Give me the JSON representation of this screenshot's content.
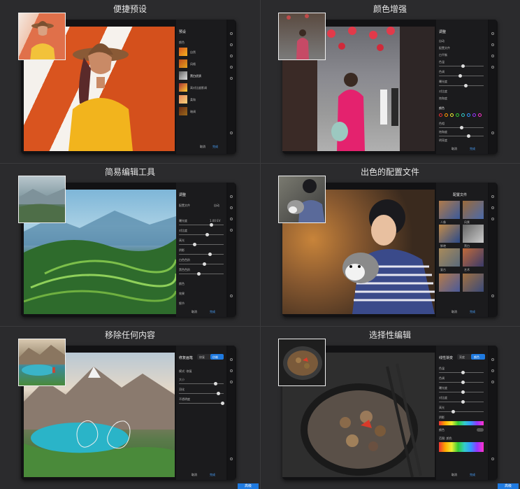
{
  "panels": [
    {
      "title": "便捷预设",
      "sidebar_header": "预设",
      "sidebar_items": [
        "颜色",
        "自然",
        "风格",
        "黑白优质",
        "高对比度影调",
        "柔和",
        "暗调"
      ],
      "buttons": [
        "取消",
        "完成"
      ]
    },
    {
      "title": "颜色增强",
      "sidebar_header": "调整",
      "sidebar_items": [
        "自动",
        "配置文件",
        "白平衡",
        "色温",
        "色调",
        "曝光度",
        "对比度",
        "饱和度",
        "颜色",
        "色相",
        "饱和度",
        "明亮度"
      ],
      "buttons": [
        "取消",
        "完成"
      ]
    },
    {
      "title": "简易编辑工具",
      "sidebar_header": "调整",
      "sidebar_items": [
        "配置文件",
        "自动",
        "曝光度",
        "对比度",
        "高光",
        "阴影",
        "白色色阶",
        "黑色色阶",
        "颜色",
        "效果",
        "细节"
      ],
      "exposure_value": "1.00 EV",
      "buttons": [
        "取消",
        "完成"
      ]
    },
    {
      "title": "出色的配置文件",
      "sidebar_header": "配置文件",
      "sidebar_items": [
        "人像",
        "风景",
        "鲜艳",
        "黑白",
        "复古",
        "艺术"
      ],
      "buttons": [
        "取消",
        "完成"
      ]
    },
    {
      "title": "移除任何内容",
      "sidebar_header": "修复画笔",
      "sidebar_items": [
        "模式: 修复",
        "大小",
        "羽化",
        "不透明度"
      ],
      "tabs": [
        "修复",
        "仿制"
      ],
      "buttons": [
        "取消",
        "完成"
      ]
    },
    {
      "title": "选择性编辑",
      "sidebar_header": "线性渐变",
      "sidebar_items": [
        "色温",
        "色调",
        "曝光度",
        "对比度",
        "高光",
        "阴影",
        "颜色",
        "范围: 颜色"
      ],
      "tabs": [
        "亮度",
        "颜色"
      ],
      "buttons": [
        "取消",
        "完成"
      ]
    }
  ],
  "badges": [
    "高级",
    "高级"
  ],
  "colors": {
    "accent": "#1f7ae0",
    "background": "#2b2b2d"
  }
}
